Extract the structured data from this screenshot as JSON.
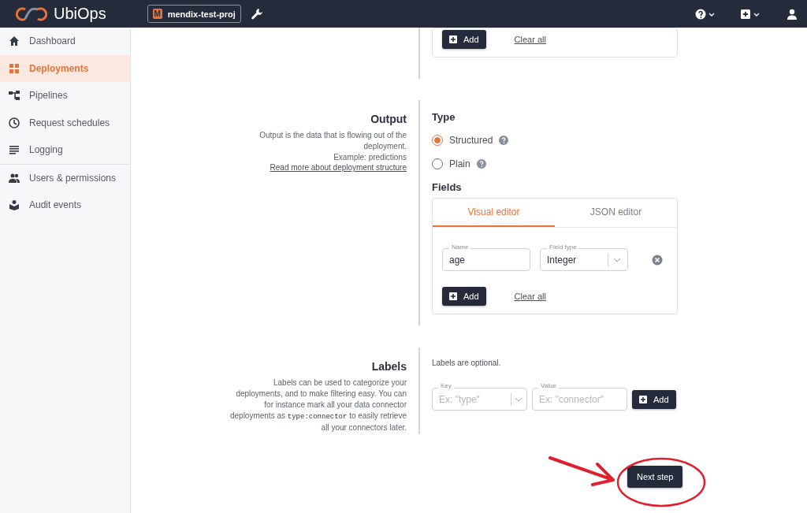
{
  "header": {
    "logo": "UbiOps",
    "project_initial": "M",
    "project": "mendix-test-proj"
  },
  "sidebar": {
    "groups": [
      {
        "items": [
          {
            "label": "Dashboard",
            "selected": false
          },
          {
            "label": "Deployments",
            "selected": true
          },
          {
            "label": "Pipelines",
            "selected": false
          },
          {
            "label": "Request schedules",
            "selected": false
          },
          {
            "label": "Logging",
            "selected": false
          }
        ]
      },
      {
        "items": [
          {
            "label": "Users & permissions",
            "selected": false
          },
          {
            "label": "Audit events",
            "selected": false
          }
        ]
      }
    ]
  },
  "top_section": {
    "add_button": "Add",
    "clear_link": "Clear all"
  },
  "output": {
    "title": "Output",
    "description": "Output is the data that is flowing out of the deployment.",
    "example": "Example: predictions",
    "link": "Read more about deployment structure",
    "type_label": "Type",
    "options": [
      {
        "label": "Structured",
        "selected": true
      },
      {
        "label": "Plain",
        "selected": false
      }
    ],
    "fields_label": "Fields",
    "tabs": [
      {
        "label": "Visual editor",
        "selected": true
      },
      {
        "label": "JSON editor",
        "selected": false
      }
    ],
    "fields": [
      {
        "name_label": "Name",
        "name": "age",
        "type_label": "Field type",
        "type": "Integer"
      }
    ],
    "add_button": "Add",
    "clear_link": "Clear all"
  },
  "labels": {
    "title": "Labels",
    "description_before": "Labels can be used to categorize your deployments, and to make filtering easy. You can for instance mark all your data connector deployments as",
    "code": "type:connector",
    "description_after": "to easily retrieve all your connectors later.",
    "hint": "Labels are optional.",
    "key": {
      "label": "Key",
      "placeholder": "Ex: \"type\""
    },
    "value": {
      "label": "Value",
      "placeholder": "Ex: \"connector\""
    },
    "add_button": "Add"
  },
  "next_button": "Next step"
}
